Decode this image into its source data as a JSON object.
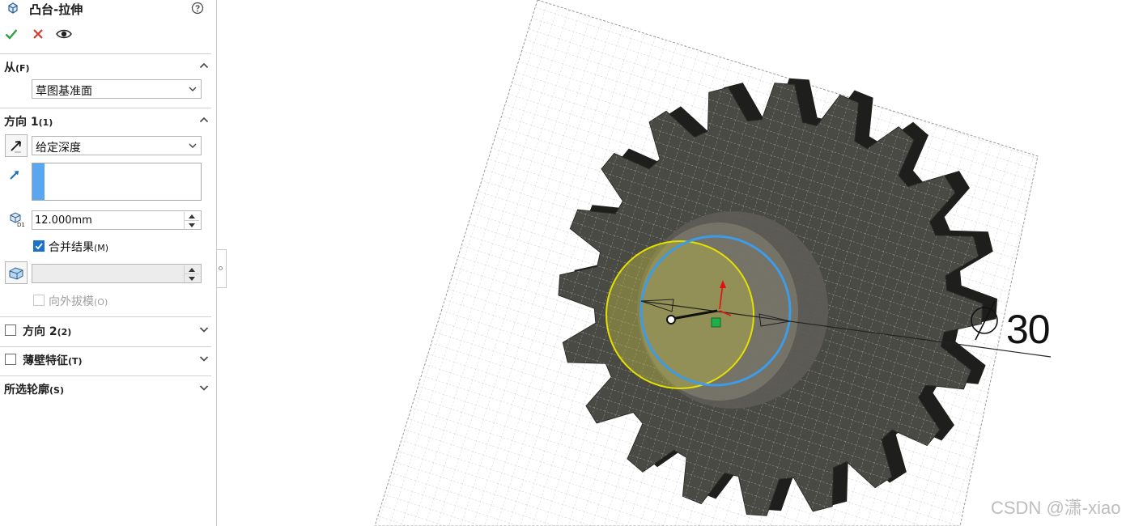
{
  "panel": {
    "title": "凸台-拉伸",
    "actions": {
      "ok": "confirm-check",
      "cancel": "cancel-x",
      "preview": "preview-eye"
    },
    "from": {
      "title": "从",
      "mnemonic": "(F)",
      "start_value": "草图基准面"
    },
    "direction1": {
      "title": "方向 1",
      "mnemonic": "(1)",
      "end_condition": "给定深度",
      "depth": "12.000mm",
      "merge_label": "合并结果",
      "merge_mnemonic": "(M)",
      "merge_checked": true,
      "draft_label": "向外拔模",
      "draft_mnemonic": "(O)",
      "draft_enabled": false
    },
    "direction2": {
      "title": "方向 2",
      "mnemonic": "(2)",
      "checked": false
    },
    "thin_feature": {
      "title": "薄壁特征",
      "mnemonic": "(T)",
      "checked": false
    },
    "selected_contours": {
      "title": "所选轮廓",
      "mnemonic": "(S)"
    }
  },
  "viewport": {
    "dimension_value": "30",
    "watermark": "CSDN @潇-xiao"
  },
  "colors": {
    "accent": "#1a73c8",
    "confirm": "#2ea043",
    "cancel": "#d33b2b",
    "gear": "#4a4a45",
    "profile_yellow": "#e4e000",
    "profile_blue": "#3d9be8"
  }
}
